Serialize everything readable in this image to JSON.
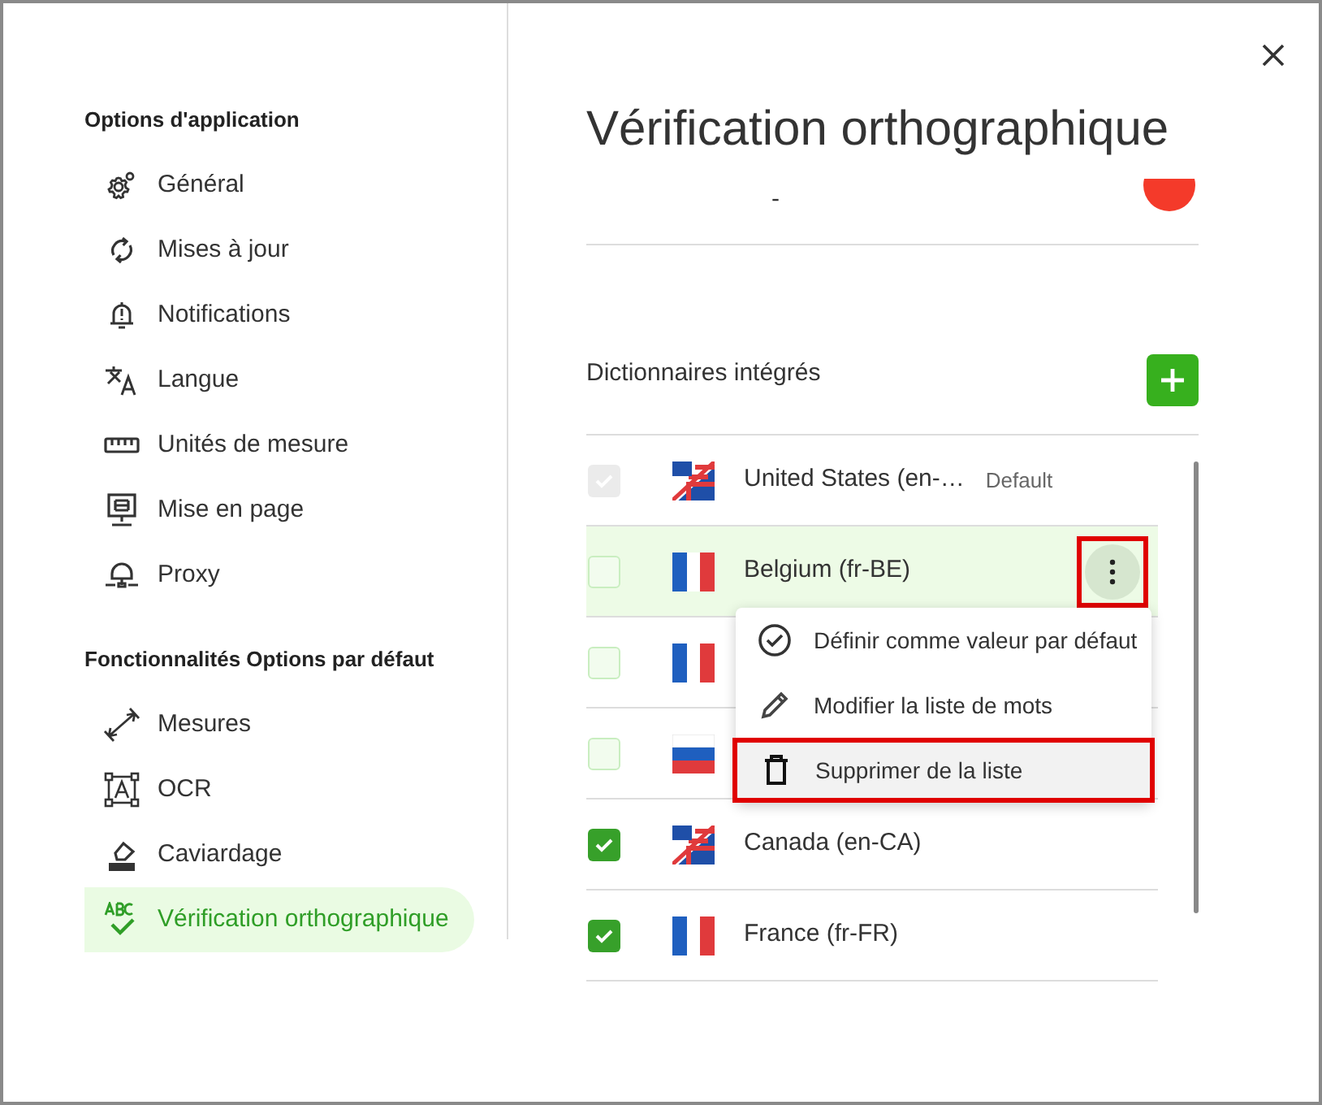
{
  "sidebar": {
    "sections": [
      {
        "heading": "Options d'application",
        "items": [
          {
            "label": "Général",
            "kind": "gear",
            "selected": false
          },
          {
            "label": "Mises à jour",
            "kind": "sync",
            "selected": false
          },
          {
            "label": "Notifications",
            "kind": "bell",
            "selected": false
          },
          {
            "label": "Langue",
            "kind": "translate",
            "selected": false
          },
          {
            "label": "Unités de mesure",
            "kind": "ruler",
            "selected": false
          },
          {
            "label": "Mise en page",
            "kind": "layout",
            "selected": false
          },
          {
            "label": "Proxy",
            "kind": "proxy",
            "selected": false
          }
        ]
      },
      {
        "heading": "Fonctionnalités Options par défaut",
        "items": [
          {
            "label": "Mesures",
            "kind": "measure",
            "selected": false
          },
          {
            "label": "OCR",
            "kind": "ocr",
            "selected": false
          },
          {
            "label": "Caviardage",
            "kind": "eraser",
            "selected": false
          },
          {
            "label": "Vérification orthographique",
            "kind": "spell",
            "selected": true
          }
        ]
      }
    ]
  },
  "page": {
    "title": "Vérification orthographique",
    "scrolled_row": {
      "text": "-"
    },
    "section_label": "Dictionnaires intégrés",
    "dictionaries": [
      {
        "kind": "en",
        "label": "United States (en-…",
        "badge": "Default",
        "checked": true,
        "disabled": true,
        "selected": false
      },
      {
        "kind": "fr",
        "label": "Belgium (fr-BE)",
        "checked": false,
        "disabled": false,
        "selected": true,
        "more_button": {
          "annotated": true
        }
      },
      {
        "kind": "fr",
        "checked": false,
        "disabled": false,
        "selected": false
      },
      {
        "kind": "ru",
        "checked": false,
        "disabled": false,
        "selected": false
      },
      {
        "kind": "en",
        "label": "Canada (en-CA)",
        "checked": true,
        "disabled": false,
        "selected": false
      },
      {
        "kind": "fr",
        "label": "France (fr-FR)",
        "checked": true,
        "disabled": false,
        "selected": false
      }
    ],
    "menu": [
      {
        "kind": "check-circle",
        "label": "Définir comme valeur par défaut",
        "hovered": false,
        "annotated": false
      },
      {
        "kind": "pencil",
        "label": "Modifier la liste de mots",
        "hovered": false,
        "annotated": false
      },
      {
        "kind": "trash",
        "label": "Supprimer de la liste",
        "hovered": true,
        "annotated": true
      }
    ]
  }
}
